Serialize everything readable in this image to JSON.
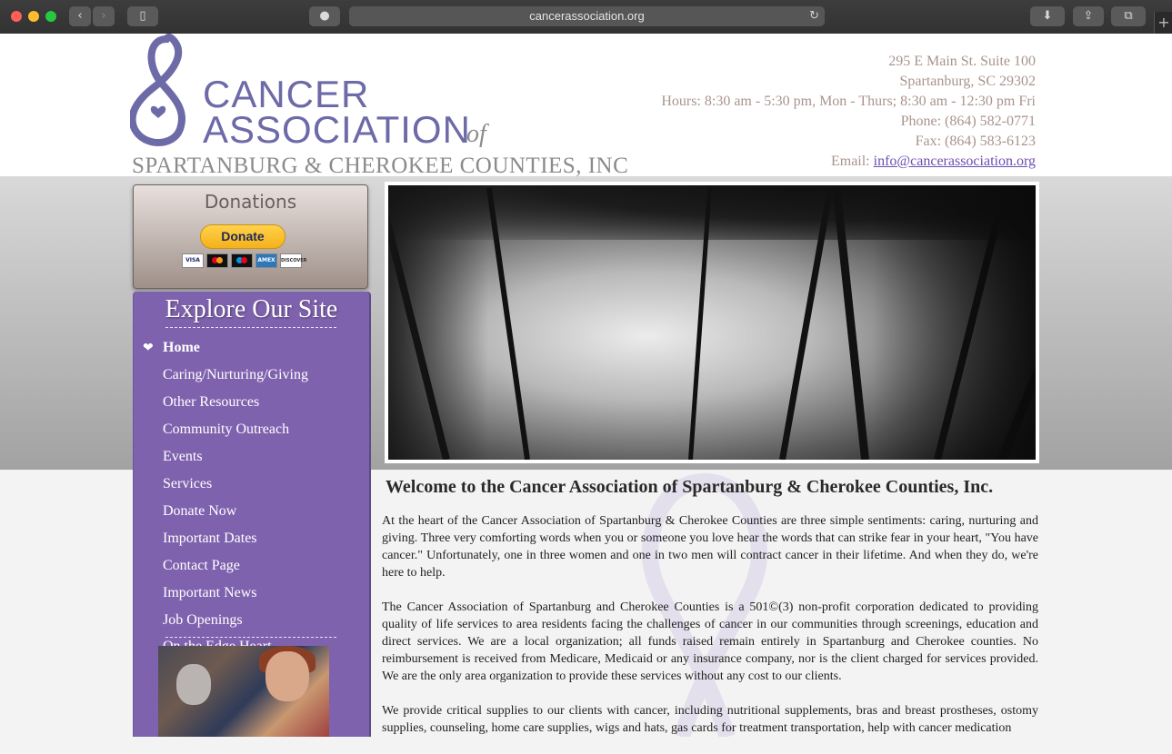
{
  "browser": {
    "url": "cancerassociation.org"
  },
  "logo": {
    "line1": "CANCER",
    "line2": "ASSOCIATION",
    "of": "of",
    "line3": "SPARTANBURG & CHEROKEE COUNTIES, INC"
  },
  "contact": {
    "address1": "295 E Main St. Suite 100",
    "address2": "Spartanburg, SC 29302",
    "hours": "Hours: 8:30 am - 5:30 pm, Mon - Thurs; 8:30 am - 12:30 pm Fri",
    "phone": "Phone: (864) 582-0771",
    "fax": "Fax: (864) 583-6123",
    "email_label": "Email: ",
    "email": "info@cancerassociation.org"
  },
  "donations": {
    "title": "Donations",
    "button": "Donate",
    "cards": [
      "VISA",
      "",
      "",
      "AMEX",
      "DISCOVER"
    ]
  },
  "nav": {
    "title": "Explore Our Site",
    "items": [
      {
        "label": "Home"
      },
      {
        "label": "Caring/Nurturing/Giving"
      },
      {
        "label": "Other Resources"
      },
      {
        "label": "Community Outreach"
      },
      {
        "label": "Events"
      },
      {
        "label": "Services"
      },
      {
        "label": "Donate Now"
      },
      {
        "label": "Important Dates"
      },
      {
        "label": "Contact Page"
      },
      {
        "label": "Important News"
      },
      {
        "label": "Job Openings"
      }
    ],
    "partial_item": "On the Edge Heart"
  },
  "main": {
    "heading": "Welcome to the Cancer Association of Spartanburg & Cherokee Counties, Inc.",
    "paragraphs": [
      "At the heart of the Cancer Association of Spartanburg & Cherokee Counties are three simple sentiments: caring, nurturing and giving. Three very comforting words when you or someone you love hear the words that can strike fear in your heart, \"You have cancer.\"  Unfortunately, one in three women and one in two men will contract cancer in their lifetime. And when they do, we're here to help.",
      "The Cancer Association of Spartanburg and Cherokee Counties is a 501©(3) non-profit corporation dedicated to providing quality of life services to area residents facing the challenges of cancer in our communities through screenings, education and direct services. We are a local organization; all funds raised remain entirely in Spartanburg and Cherokee counties. No reimbursement is received from Medicare, Medicaid or any insurance company, nor is the client charged for services provided. We are the only area organization to provide these services without any cost to our clients.",
      "We provide critical supplies to our clients with cancer, including nutritional supplements, bras and breast prostheses, ostomy supplies, counseling, home care supplies, wigs and hats, gas cards for treatment transportation, help with cancer medication"
    ]
  }
}
